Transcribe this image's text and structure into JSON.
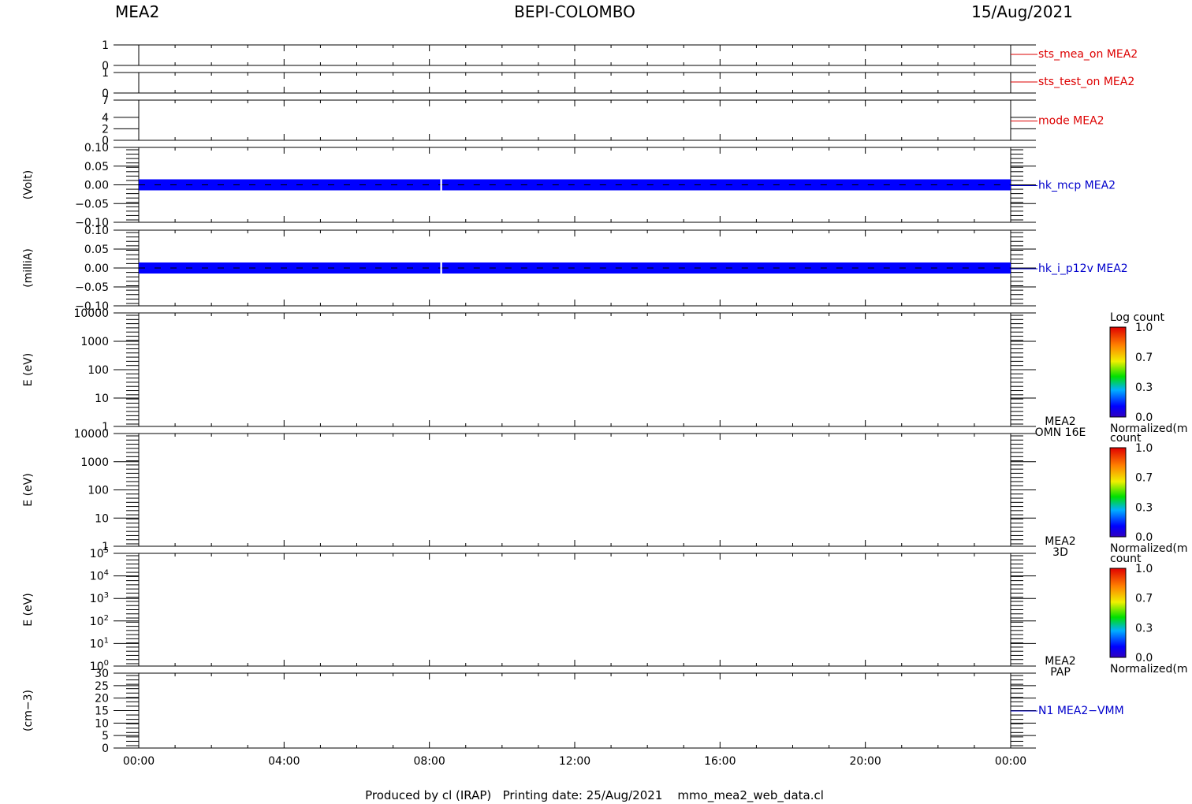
{
  "header": {
    "left": "MEA2",
    "center": "BEPI-COLOMBO",
    "right": "15/Aug/2021"
  },
  "footer": "Produced by cl (IRAP)   Printing date: 25/Aug/2021    mmo_mea2_web_data.cl",
  "colors": {
    "red_label": "#dd0000",
    "blue_label": "#0000cc",
    "series_fill": "#0000ff"
  },
  "chart_data": [
    {
      "type": "line",
      "label": "sts_mea_on MEA2",
      "label_color": "#dd0000",
      "ylim": [
        0,
        1
      ],
      "y_ticks": [
        "1",
        "0"
      ],
      "series": []
    },
    {
      "type": "line",
      "label": "sts_test_on MEA2",
      "label_color": "#dd0000",
      "ylim": [
        0,
        1
      ],
      "y_ticks": [
        "1",
        "0"
      ],
      "series": []
    },
    {
      "type": "line",
      "label": "mode MEA2",
      "label_color": "#dd0000",
      "ylim": [
        0,
        7
      ],
      "y_ticks": [
        "7",
        "4",
        "2",
        "0"
      ],
      "series": []
    },
    {
      "type": "line",
      "label": "hk_mcp MEA2",
      "label_color": "#0000cc",
      "ylabel": "(Volt)",
      "ylim": [
        -0.1,
        0.1
      ],
      "y_ticks": [
        "0.10",
        "0.05",
        "0.00",
        "−0.05",
        "−0.10"
      ],
      "series": [
        {
          "x": [
            "00:00",
            "08:18"
          ],
          "y": [
            0.0,
            0.0
          ]
        },
        {
          "x": [
            "08:21",
            "24:00"
          ],
          "y": [
            0.0,
            0.0
          ]
        }
      ]
    },
    {
      "type": "line",
      "label": "hk_i_p12v MEA2",
      "label_color": "#0000cc",
      "ylabel": "(milliA)",
      "ylim": [
        -0.1,
        0.1
      ],
      "y_ticks": [
        "0.10",
        "0.05",
        "0.00",
        "−0.05",
        "−0.10"
      ],
      "series": [
        {
          "x": [
            "00:00",
            "08:18"
          ],
          "y": [
            0.0,
            0.0
          ]
        },
        {
          "x": [
            "08:21",
            "24:00"
          ],
          "y": [
            0.0,
            0.0
          ]
        }
      ]
    },
    {
      "type": "heatmap",
      "label_lines": [
        "MEA2",
        "OMN 16E"
      ],
      "ylabel": "E (eV)",
      "ylim": [
        1,
        10000
      ],
      "y_scale": "log",
      "y_ticks": [
        "10000",
        "1000",
        "100",
        "10",
        "1"
      ],
      "colorbar": {
        "title": "Log count",
        "ticks": [
          "1.0",
          "0.7",
          "0.3",
          "0.0"
        ],
        "subtitle": "Normalized(m"
      },
      "values": []
    },
    {
      "type": "heatmap",
      "label_lines": [
        "MEA2",
        "3D"
      ],
      "ylabel": "E (eV)",
      "ylim": [
        1,
        10000
      ],
      "y_scale": "log",
      "y_ticks": [
        "10000",
        "1000",
        "100",
        "10",
        "1"
      ],
      "colorbar": {
        "title": "count",
        "ticks": [
          "1.0",
          "0.7",
          "0.3",
          "0.0"
        ],
        "subtitle": "Normalized(m"
      },
      "values": []
    },
    {
      "type": "heatmap",
      "label_lines": [
        "MEA2",
        "PAP"
      ],
      "ylabel": "E (eV)",
      "ylim": [
        1,
        100000
      ],
      "y_scale": "log",
      "y_ticks_pow": [
        "5",
        "4",
        "3",
        "2",
        "1",
        "0"
      ],
      "colorbar": {
        "title": "count",
        "ticks": [
          "1.0",
          "0.7",
          "0.3",
          "0.0"
        ],
        "subtitle": "Normalized(m"
      },
      "values": []
    },
    {
      "type": "line",
      "label": "N1 MEA2−VMM",
      "label_color": "#0000cc",
      "ylabel": "(cm−3)",
      "ylim": [
        0,
        30
      ],
      "y_ticks": [
        "30",
        "25",
        "20",
        "15",
        "10",
        "5",
        "0"
      ],
      "series": []
    }
  ],
  "x_axis": {
    "ticks": [
      "00:00",
      "04:00",
      "08:00",
      "12:00",
      "16:00",
      "20:00",
      "00:00"
    ],
    "xlim_hours": [
      0,
      24
    ]
  }
}
